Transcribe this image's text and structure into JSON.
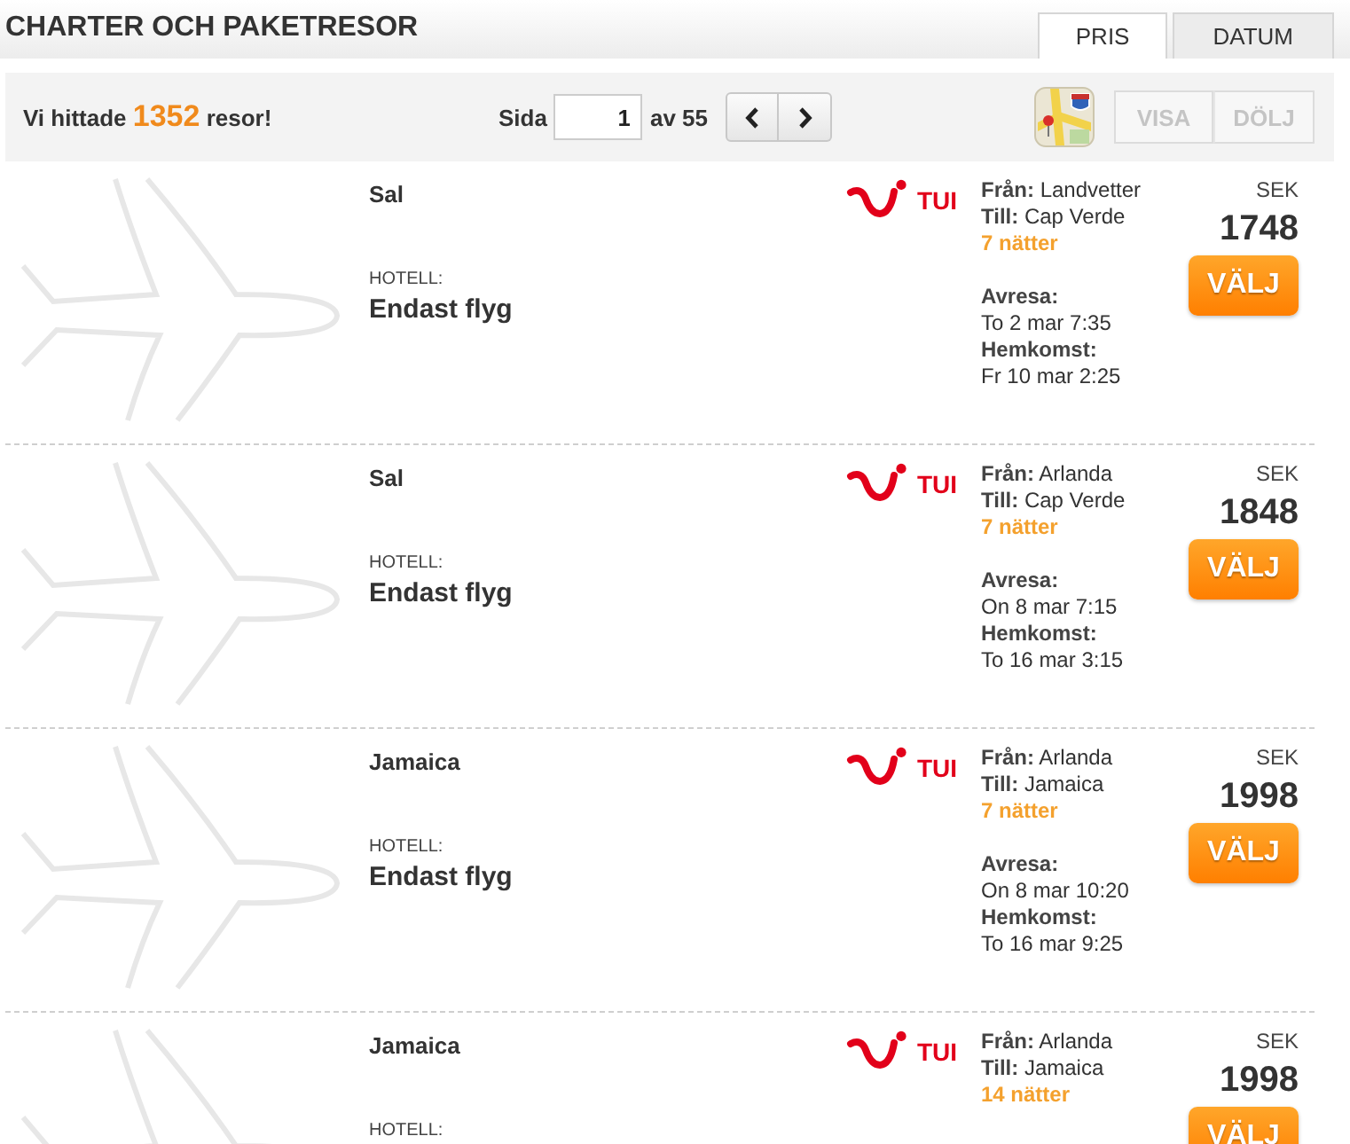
{
  "header": {
    "title": "CHARTER OCH PAKETRESOR",
    "tabs": [
      {
        "label": "PRIS",
        "selected": true
      },
      {
        "label": "DATUM",
        "selected": false
      }
    ]
  },
  "toolbar": {
    "result_text": "Vi hittade **1352** resor!",
    "page_label": "Sida",
    "page_field": {
      "value": "1"
    },
    "page_total": "av 55",
    "view_buttons": [
      {
        "label": "VISA",
        "disabled": true
      },
      {
        "label": "DÖLJ",
        "disabled": true
      }
    ]
  },
  "results": [
    {
      "destination": "Sal",
      "hotel_label": "HOTELL:",
      "hotel": "Endast flyg",
      "operator": "TUI",
      "from": "**Från:** Landvetter",
      "to": "**Till:** Cap Verde",
      "nights": "7 nätter",
      "departure_label": "Avresa:",
      "departure": "To 2 mar 7:35",
      "return_label": "Hemkomst:",
      "return": "Fr 10 mar 2:25",
      "currency": "SEK",
      "price": "1748",
      "button": "VÄLJ"
    },
    {
      "destination": "Sal",
      "hotel_label": "HOTELL:",
      "hotel": "Endast flyg",
      "operator": "TUI",
      "from": "**Från:** Arlanda",
      "to": "**Till:** Cap Verde",
      "nights": "7 nätter",
      "departure_label": "Avresa:",
      "departure": "On 8 mar 7:15",
      "return_label": "Hemkomst:",
      "return": "To 16 mar 3:15",
      "currency": "SEK",
      "price": "1848",
      "button": "VÄLJ"
    },
    {
      "destination": "Jamaica",
      "hotel_label": "HOTELL:",
      "hotel": "Endast flyg",
      "operator": "TUI",
      "from": "**Från:** Arlanda",
      "to": "**Till:** Jamaica",
      "nights": "7 nätter",
      "departure_label": "Avresa:",
      "departure": "On 8 mar 10:20",
      "return_label": "Hemkomst:",
      "return": "To 16 mar 9:25",
      "currency": "SEK",
      "price": "1998",
      "button": "VÄLJ"
    },
    {
      "destination": "Jamaica",
      "hotel_label": "HOTELL:",
      "operator": "TUI",
      "from": "**Från:** Arlanda",
      "to": "**Till:** Jamaica",
      "nights": "14 nätter",
      "currency": "SEK",
      "price": "1998",
      "button": "VÄLJ"
    }
  ]
}
